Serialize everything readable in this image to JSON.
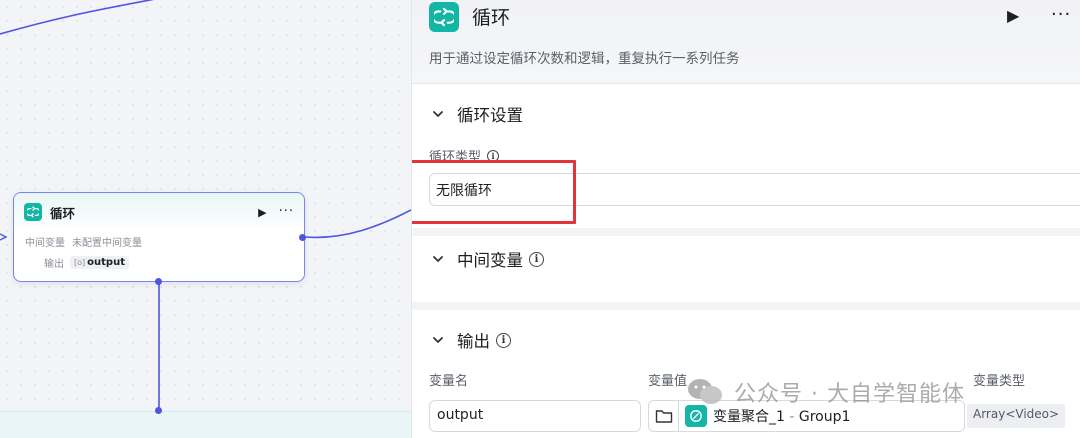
{
  "node": {
    "title": "循环",
    "mid_var_label": "中间变量",
    "mid_var_value": "未配置中间变量",
    "output_label": "输出",
    "output_type": "[o]",
    "output_chip": "output",
    "icons": [
      "loop-icon",
      "play-icon",
      "more-icon"
    ]
  },
  "panel": {
    "title": "循环",
    "description": "用于通过设定循环次数和逻辑，重复执行一系列任务",
    "loop_settings": {
      "title": "循环设置",
      "field_label": "循环类型",
      "selected_value": "无限循环"
    },
    "mid_vars": {
      "title": "中间变量"
    },
    "output": {
      "title": "输出",
      "col_name": "变量名",
      "col_value": "变量值",
      "col_type": "变量类型",
      "row": {
        "name": "output",
        "value_prefix": "变量聚合_1",
        "value_sep": " - ",
        "value_suffix": "Group1",
        "type": "Array<Video>"
      }
    },
    "icons": [
      "loop-icon",
      "play-icon",
      "more-icon",
      "chevron-down-icon",
      "info-icon",
      "folder-icon"
    ]
  },
  "watermark": {
    "text": "公众号 · 大自学智能体"
  },
  "colors": {
    "accent": "#13b5a4",
    "wire": "#4e55e0",
    "highlight": "#e3343b"
  }
}
